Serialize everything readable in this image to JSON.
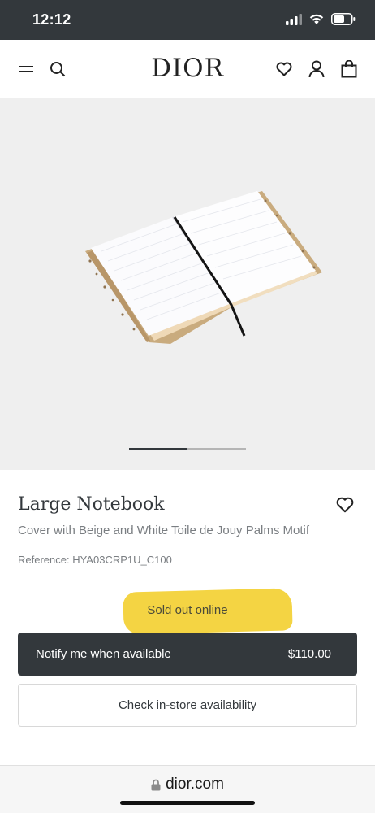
{
  "status_bar": {
    "time": "12:12"
  },
  "header": {
    "logo": "DIOR"
  },
  "gallery": {
    "progress": 0.5
  },
  "product": {
    "title": "Large Notebook",
    "subtitle": "Cover with Beige and White Toile de Jouy Palms Motif",
    "reference": "Reference: HYA03CRP1U_C100",
    "availability": "Sold out online"
  },
  "actions": {
    "notify_label": "Notify me when available",
    "price": "$110.00",
    "store_label": "Check in-store availability"
  },
  "browser": {
    "url": "dior.com"
  },
  "colors": {
    "dark": "#33383c",
    "highlight": "#f4d443",
    "gallery_bg": "#efefef"
  },
  "icons": [
    "signal-icon",
    "wifi-icon",
    "battery-icon",
    "menu-icon",
    "search-icon",
    "heart-icon",
    "account-icon",
    "bag-icon",
    "lock-icon"
  ]
}
